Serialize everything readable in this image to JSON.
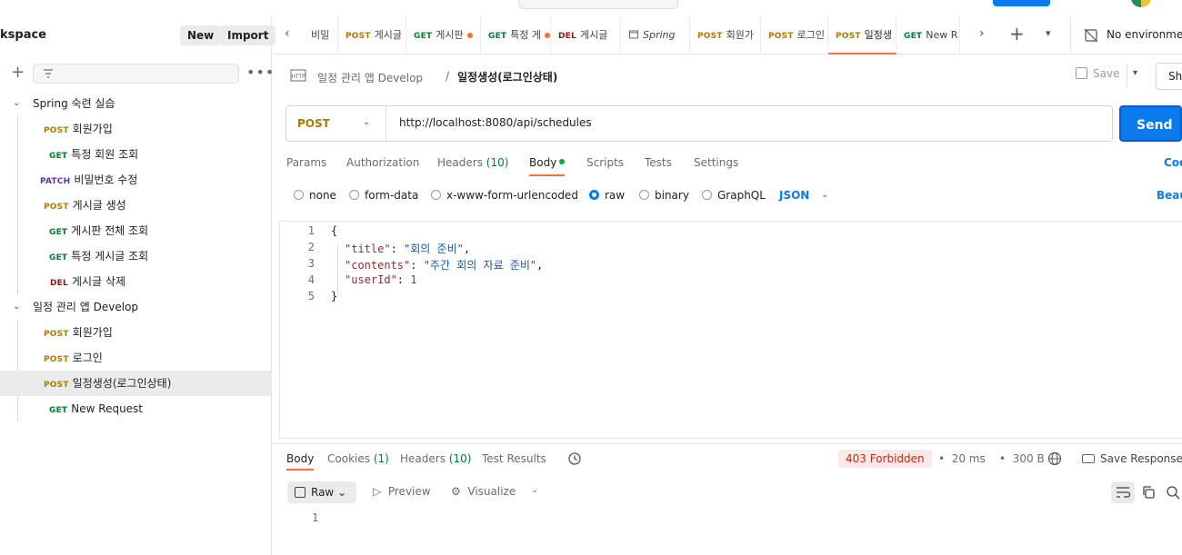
{
  "sidebar": {
    "workspace_title": "kspace",
    "new_label": "New",
    "import_label": "Import",
    "collections": [
      {
        "name": "Spring 숙련 실습",
        "requests": [
          {
            "method": "POST",
            "name": "회원가입"
          },
          {
            "method": "GET",
            "name": "특정 회원 조회"
          },
          {
            "method": "PATCH",
            "name": "비밀번호 수정"
          },
          {
            "method": "POST",
            "name": "게시글 생성"
          },
          {
            "method": "GET",
            "name": "게시판 전체 조회"
          },
          {
            "method": "GET",
            "name": "특정 게시글 조회"
          },
          {
            "method": "DEL",
            "name": "게시글 삭제"
          }
        ]
      },
      {
        "name": "일정 관리 앱 Develop",
        "requests": [
          {
            "method": "POST",
            "name": "회원가입"
          },
          {
            "method": "POST",
            "name": "로그인"
          },
          {
            "method": "POST",
            "name": "일정생성(로그인상태)"
          },
          {
            "method": "GET",
            "name": "New Request"
          }
        ]
      }
    ]
  },
  "tabs": [
    {
      "method": "",
      "name": "비밀"
    },
    {
      "method": "POST",
      "name": "게시글"
    },
    {
      "method": "GET",
      "name": "게시판"
    },
    {
      "method": "GET",
      "name": "특정 게"
    },
    {
      "method": "DEL",
      "name": "게시글"
    },
    {
      "method": "",
      "name": "Spring"
    },
    {
      "method": "POST",
      "name": "회원가"
    },
    {
      "method": "POST",
      "name": "로그인"
    },
    {
      "method": "POST",
      "name": "일정생"
    },
    {
      "method": "GET",
      "name": "New R"
    }
  ],
  "environment": {
    "label": "No environment"
  },
  "request": {
    "breadcrumb_collection": "일정 관리 앱 Develop",
    "breadcrumb_sep": "/",
    "breadcrumb_request": "일정생성(로그인상태)",
    "save_label": "Save",
    "share_label": "Sh",
    "method": "POST",
    "url": "http://localhost:8080/api/schedules",
    "send_label": "Send",
    "subtabs": {
      "params": "Params",
      "authorization": "Authorization",
      "headers": "Headers",
      "headers_count": "(10)",
      "body": "Body",
      "scripts": "Scripts",
      "tests": "Tests",
      "settings": "Settings",
      "cookies": "Coo"
    },
    "body_modes": {
      "none": "none",
      "form_data": "form-data",
      "urlencoded": "x-www-form-urlencoded",
      "raw": "raw",
      "binary": "binary",
      "graphql": "GraphQL",
      "language": "JSON",
      "beautify": "Beau"
    },
    "body_lines": [
      {
        "num": "1",
        "text": "{"
      },
      {
        "num": "2",
        "key": "\"title\"",
        "value": "\"회의 준비\"",
        "trail": ","
      },
      {
        "num": "3",
        "key": "\"contents\"",
        "value": "\"주간 회의 자료 준비\"",
        "trail": ","
      },
      {
        "num": "4",
        "key": "\"userId\"",
        "number": "1",
        "trail": ""
      },
      {
        "num": "5",
        "text": "}"
      }
    ]
  },
  "response": {
    "tabs": {
      "body": "Body",
      "cookies": "Cookies",
      "cookies_count": "(1)",
      "headers": "Headers",
      "headers_count": "(10)",
      "test_results": "Test Results"
    },
    "status": "403 Forbidden",
    "time": "20 ms",
    "size": "300 B",
    "save_response": "Save Response",
    "format": "Raw",
    "preview": "Preview",
    "visualize": "Visualize",
    "line_number": "1"
  },
  "colors": {
    "accent": "#ff6c37",
    "send": "#097bed",
    "post": "#ad7a03",
    "get": "#007f31",
    "patch": "#623497",
    "del": "#8e1a10",
    "forbidden": "#c0291b"
  }
}
